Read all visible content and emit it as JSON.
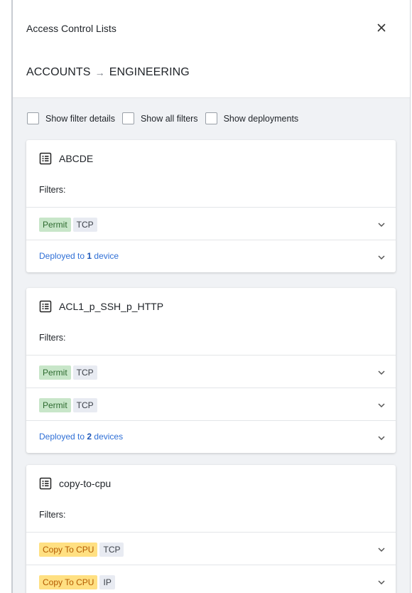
{
  "panel": {
    "title": "Access Control Lists",
    "breadcrumb": {
      "from": "ACCOUNTS",
      "arrow": "→",
      "to": "ENGINEERING"
    }
  },
  "options": [
    {
      "label": "Show filter details",
      "checked": false
    },
    {
      "label": "Show all filters",
      "checked": false
    },
    {
      "label": "Show deployments",
      "checked": false
    }
  ],
  "acls": [
    {
      "name": "ABCDE",
      "filters_label": "Filters:",
      "filters": [
        {
          "action": "Permit",
          "action_type": "permit",
          "protocol": "TCP"
        }
      ],
      "deploy": {
        "prefix": "Deployed to ",
        "count": "1",
        "suffix": " device"
      }
    },
    {
      "name": "ACL1_p_SSH_p_HTTP",
      "filters_label": "Filters:",
      "filters": [
        {
          "action": "Permit",
          "action_type": "permit",
          "protocol": "TCP"
        },
        {
          "action": "Permit",
          "action_type": "permit",
          "protocol": "TCP"
        }
      ],
      "deploy": {
        "prefix": "Deployed to ",
        "count": "2",
        "suffix": " devices"
      }
    },
    {
      "name": "copy-to-cpu",
      "filters_label": "Filters:",
      "filters": [
        {
          "action": "Copy To CPU",
          "action_type": "cpu",
          "protocol": "TCP"
        },
        {
          "action": "Copy To CPU",
          "action_type": "cpu",
          "protocol": "IP"
        }
      ]
    }
  ],
  "colors": {
    "permit_bg": "#c8e6c9",
    "permit_text": "#2e6b30",
    "cpu_bg": "#ffe082",
    "cpu_text": "#b35a00",
    "link": "#2f6fd6",
    "body_bg": "#f0f2f5"
  }
}
